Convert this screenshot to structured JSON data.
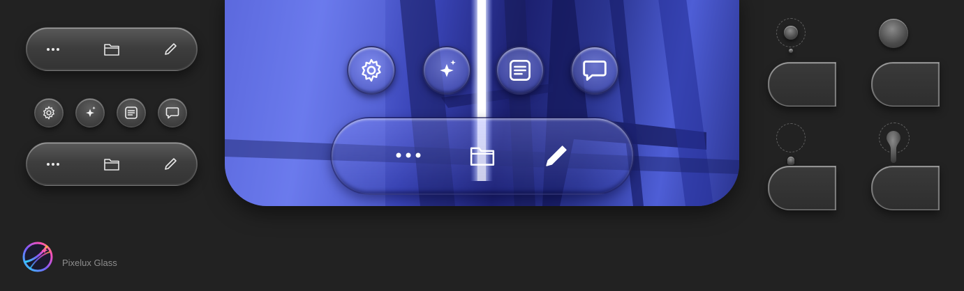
{
  "brand": {
    "name": "Pixelux Glass",
    "logo_icon": "globe-sparkle-icon"
  },
  "toolbar_top": {
    "items": [
      {
        "name": "more",
        "icon": "more-dots-icon"
      },
      {
        "name": "folder",
        "icon": "folder-icon"
      },
      {
        "name": "edit",
        "icon": "pencil-icon"
      }
    ]
  },
  "circle_buttons": {
    "items": [
      {
        "name": "settings",
        "icon": "gear-icon"
      },
      {
        "name": "ai",
        "icon": "sparkle-icon"
      },
      {
        "name": "notes",
        "icon": "document-icon"
      },
      {
        "name": "chat",
        "icon": "chat-bubble-icon"
      }
    ]
  },
  "toolbar_bottom": {
    "items": [
      {
        "name": "more",
        "icon": "more-dots-icon"
      },
      {
        "name": "folder",
        "icon": "folder-icon"
      },
      {
        "name": "edit",
        "icon": "pencil-icon"
      }
    ]
  },
  "preview": {
    "circle_buttons": [
      "gear-icon",
      "sparkle-icon",
      "document-icon",
      "chat-bubble-icon"
    ],
    "toolbar": [
      "more-dots-icon",
      "folder-icon",
      "pencil-icon"
    ],
    "accent_color": "#5a67e0"
  },
  "colors": {
    "background": "#222222",
    "panel_glass": "#3a3a3a",
    "brand_text": "#8e8e8e"
  }
}
